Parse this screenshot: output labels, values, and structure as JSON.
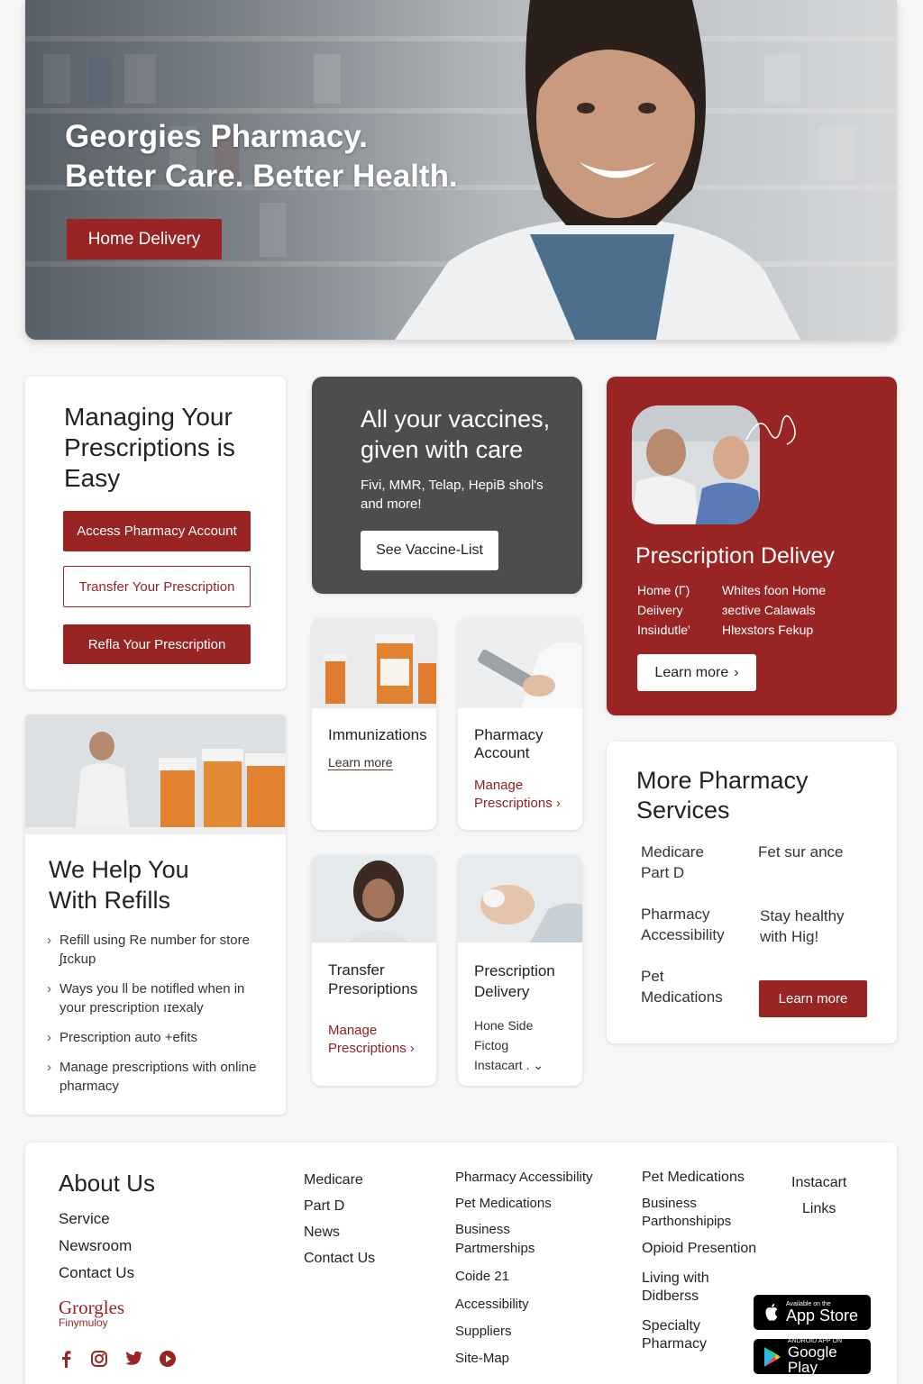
{
  "hero": {
    "line1": "Georgies Pharmacy.",
    "line2": "Better Care. Better Health.",
    "button": "Home Delivery"
  },
  "manage": {
    "title": "Managing Your Prescriptions is Easy",
    "buttons": [
      "Access Pharmacy Account",
      "Transfer Your Prescription",
      "Refla Your Prescription"
    ]
  },
  "vaccines": {
    "title": "All your vaccines, given with care",
    "subtitle": "Fivi, MMR, Telap, HepiB shol's and more!",
    "button": "See Vaccine-List"
  },
  "delivery": {
    "title": "Prescription Delivey",
    "col1": [
      "Home (Γ)",
      "Deiivery",
      "Insiıdutle'"
    ],
    "col2": [
      "Whites foon Home",
      "ɜective Calawals",
      "Hlɐxstors Fekup"
    ],
    "button": "Learn more",
    "colors": {
      "bg": "#992424"
    }
  },
  "tiles": {
    "immunizations": {
      "title": "Immunizations",
      "link": "Learn more"
    },
    "pharmacy_account": {
      "title": "Pharmacy Account",
      "link": "Manage Prescriptions ›"
    },
    "transfer": {
      "title": "Transfer Presoriptions",
      "link": "Manage Prescriptions ›"
    },
    "prescription_delivery": {
      "title": "Prescription Delivery",
      "lines": [
        "Hone Side",
        "Fictog",
        "Instacart . ⌄"
      ]
    }
  },
  "refills": {
    "title": "We Help You With Refills",
    "items": [
      "Refill using Re number for store ʃɪckup",
      "Ways you ll be notifled when in your prescription ıɪexaly",
      "Prescription auto +efits",
      "Manage prescriptions with online pharmacy"
    ]
  },
  "more": {
    "title": "More Pharmacy Services",
    "items": [
      "Medicare Part D",
      "Fet sur ance",
      "Pharmacy Accessibility",
      "Stay healthy with Hig!",
      "Pet Medications"
    ],
    "button": "Learn more"
  },
  "footer": {
    "about": "About Us",
    "col0": [
      "Service",
      "Newsroom",
      "Contact Us"
    ],
    "logo_main": "Grorgles",
    "logo_sub": "Finymuloy",
    "col1": [
      "Medicare",
      "Part D",
      "News",
      "Contact Us"
    ],
    "col2": [
      "Pharmacy Accessibility",
      "Pet Medications",
      "Business Partmerships",
      "Coide  21",
      "Accessibility",
      "Suppliers",
      "Site-Map"
    ],
    "col3": [
      "Pet Medications",
      "Business Parthonshipips",
      "Opioid Presention",
      "Living with Didberss",
      "Specialty Pharmacy"
    ],
    "col4": [
      "Instacart",
      "Links"
    ],
    "appstore_small": "Available on the",
    "appstore": "App Store",
    "googleplay_small": "ANDROID APP ON",
    "googleplay": "Google Play",
    "social_icons": [
      "facebook-icon",
      "instagram-icon",
      "twitter-icon",
      "pinterest-icon"
    ]
  },
  "colors": {
    "accent": "#992424",
    "dark_card": "#4d4d4d"
  }
}
